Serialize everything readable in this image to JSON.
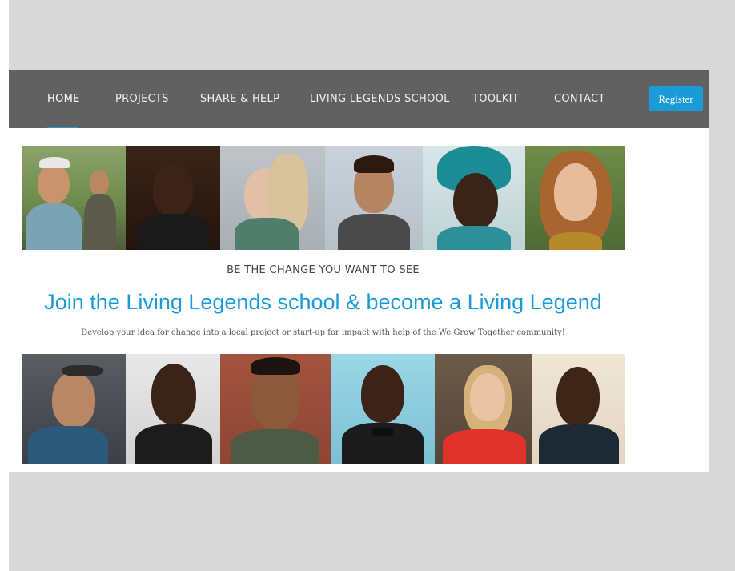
{
  "nav": {
    "items": [
      {
        "label": "HOME",
        "active": true
      },
      {
        "label": "PROJECTS",
        "active": false
      },
      {
        "label": "SHARE & HELP",
        "active": false
      },
      {
        "label": "LIVING LEGENDS SCHOOL",
        "active": false
      },
      {
        "label": "TOOLKIT",
        "active": false
      },
      {
        "label": "CONTACT",
        "active": false
      }
    ],
    "register_label": "Register",
    "accent_color": "#1a9bd7",
    "bar_color": "#616161"
  },
  "hero": {
    "tagline": "BE THE CHANGE YOU WANT TO SEE",
    "headline": "Join the Living Legends school & become a Living Legend",
    "subtext": "Develop your idea for change into a local project or start-up for impact with help of the We Grow Together community!"
  },
  "photos": {
    "top": [
      "hikers",
      "man-dark-background",
      "woman-scarf",
      "man-outdoor",
      "woman-headwrap",
      "woman-curly-hair"
    ],
    "bottom": [
      "man-sunglasses",
      "man-smiling",
      "man-brick-wall",
      "man-bowtie",
      "woman-red-top",
      "man-thinking"
    ]
  }
}
